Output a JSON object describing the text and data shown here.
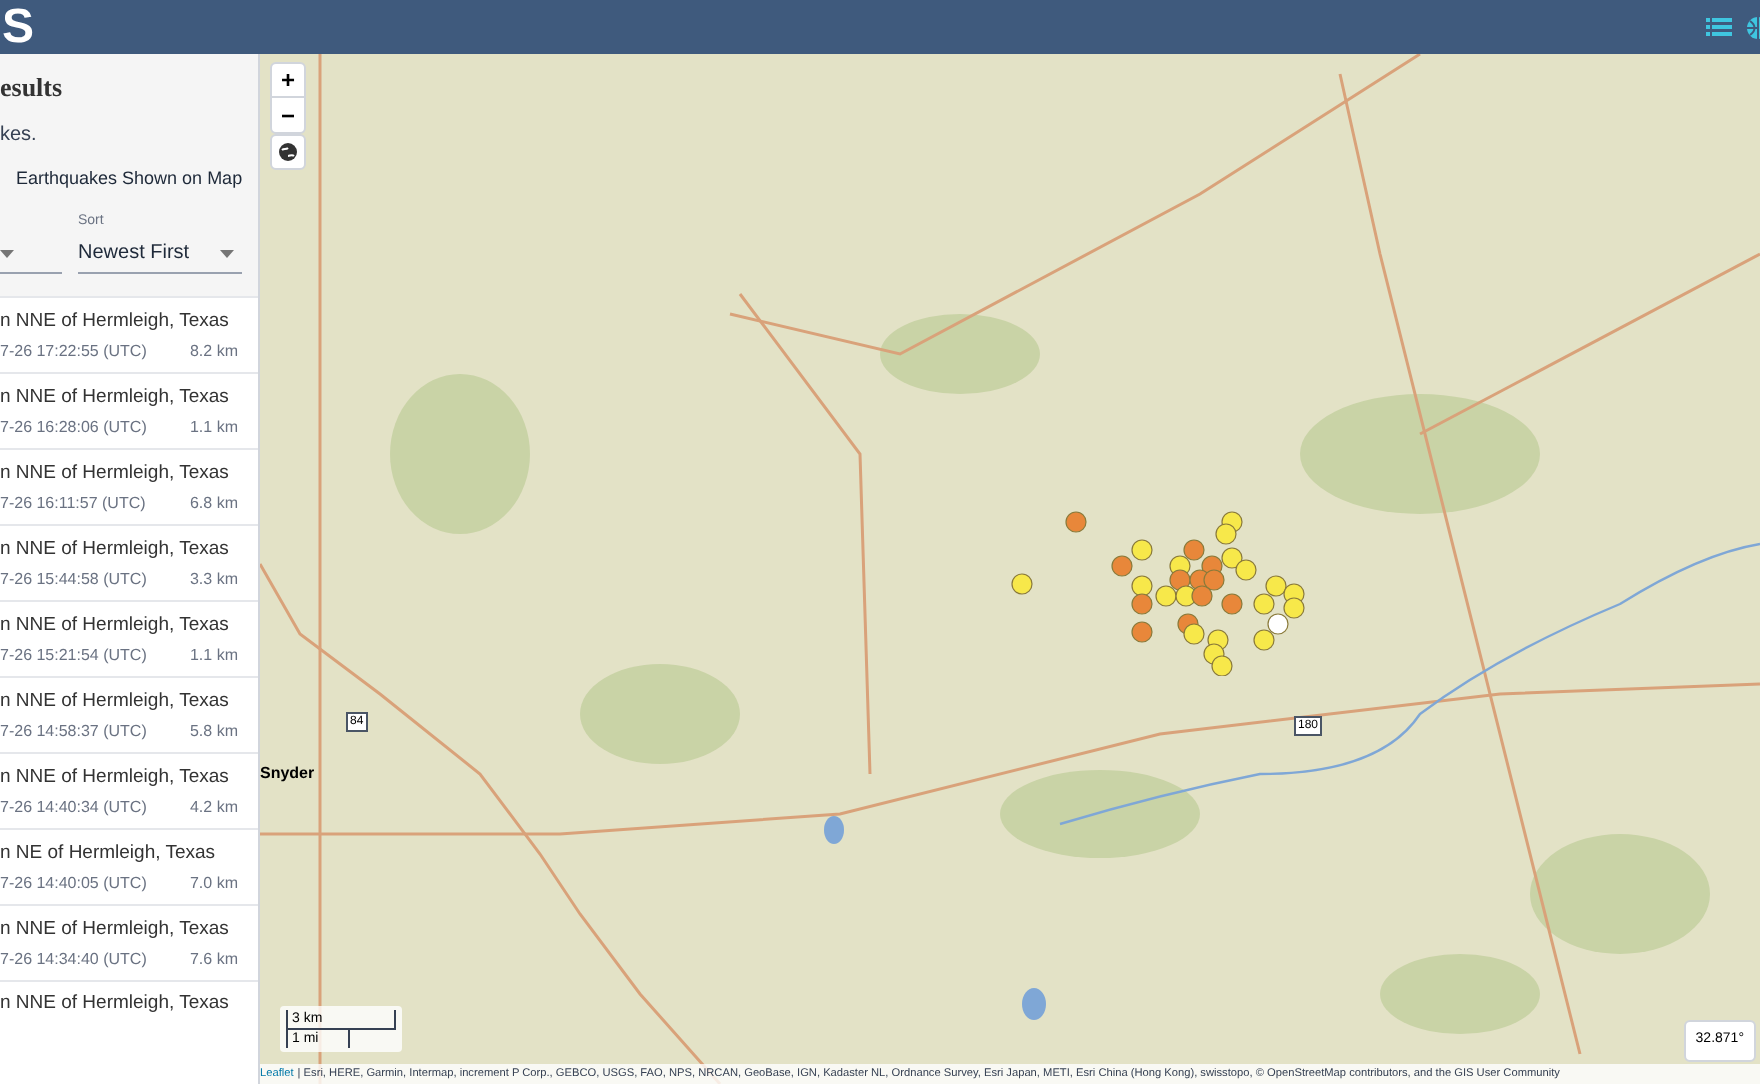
{
  "header": {
    "logo_text": "S"
  },
  "sidebar": {
    "title": "esults",
    "summary": "kes.",
    "map_toggle": {
      "label": "Earthquakes Shown on Map"
    },
    "filters": [
      {
        "kind": "select"
      },
      {
        "kind": "select",
        "label": "Sort",
        "value": "Newest First"
      }
    ],
    "earthquakes": [
      {
        "title": "n NNE of Hermleigh, Texas",
        "time": "7-26 17:22:55 (UTC)",
        "depth": "8.2 km"
      },
      {
        "title": "n NNE of Hermleigh, Texas",
        "time": "7-26 16:28:06 (UTC)",
        "depth": "1.1 km"
      },
      {
        "title": "n NNE of Hermleigh, Texas",
        "time": "7-26 16:11:57 (UTC)",
        "depth": "6.8 km"
      },
      {
        "title": "n NNE of Hermleigh, Texas",
        "time": "7-26 15:44:58 (UTC)",
        "depth": "3.3 km"
      },
      {
        "title": "n NNE of Hermleigh, Texas",
        "time": "7-26 15:21:54 (UTC)",
        "depth": "1.1 km"
      },
      {
        "title": "n NNE of Hermleigh, Texas",
        "time": "7-26 14:58:37 (UTC)",
        "depth": "5.8 km"
      },
      {
        "title": "n NNE of Hermleigh, Texas",
        "time": "7-26 14:40:34 (UTC)",
        "depth": "4.2 km"
      },
      {
        "title": "n NE of Hermleigh, Texas",
        "time": "7-26 14:40:05 (UTC)",
        "depth": "7.0 km"
      },
      {
        "title": "n NNE of Hermleigh, Texas",
        "time": "7-26 14:34:40 (UTC)",
        "depth": "7.6 km"
      },
      {
        "title": "n NNE of Hermleigh, Texas"
      }
    ]
  },
  "map": {
    "zoom_in": "+",
    "zoom_out": "−",
    "labels": [
      "Snyder",
      "84",
      "180"
    ],
    "scale": [
      "3 km",
      "1 mi"
    ],
    "attribution_link": "Leaflet",
    "attribution": "| Esri, HERE, Garmin, Intermap, increment P Corp., GEBCO, USGS, FAO, NPS, NRCAN, GeoBase, IGN, Kadaster NL, Ordnance Survey, Esri Japan, METI, Esri China (Hong Kong), swisstopo, © OpenStreetMap contributors, and the GIS User Community",
    "coordinates": "32.871°"
  }
}
